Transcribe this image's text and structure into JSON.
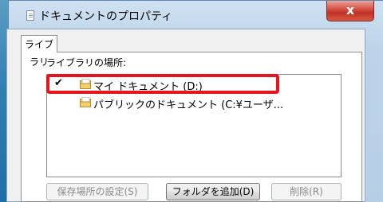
{
  "window": {
    "title": "ドキュメントのプロパティ",
    "close_glyph": "x"
  },
  "tab": {
    "label": "ライブラリ"
  },
  "library": {
    "location_label": "ライブラリの場所:",
    "items": [
      {
        "check": "✔",
        "label": "マイ ドキュメント (D:)"
      },
      {
        "check": "",
        "label": "パブリックのドキュメント (C:¥ユーザ..."
      }
    ]
  },
  "buttons": {
    "set_save_location": "保存場所の設定(S)",
    "add_folder": "フォルダを追加(D)",
    "delete": "削除(R)"
  },
  "colors": {
    "highlight": "#e8141c",
    "folder": "#e8c25a"
  },
  "icons": {
    "title": "document-icon",
    "close": "close-icon",
    "folder": "folder-icon",
    "check": "checkmark-icon"
  }
}
